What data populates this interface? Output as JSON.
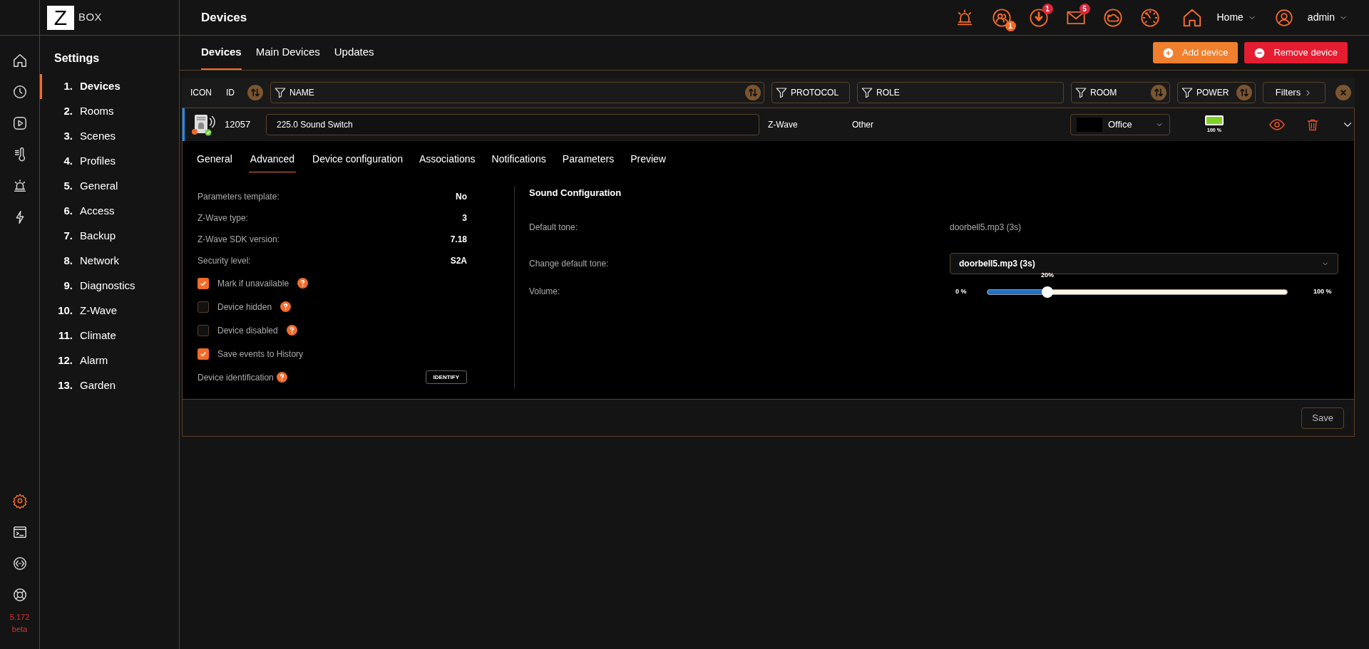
{
  "logo": {
    "letter": "Z",
    "word": "BOX"
  },
  "rail": {
    "top": [
      {
        "kind": "home",
        "selected": false
      },
      {
        "kind": "clock",
        "selected": false
      },
      {
        "kind": "play",
        "selected": false
      },
      {
        "kind": "thermometer",
        "selected": false
      },
      {
        "kind": "siren",
        "selected": false
      },
      {
        "kind": "bolt",
        "selected": false
      }
    ],
    "bottom": [
      {
        "kind": "gear",
        "selected": true
      },
      {
        "kind": "terminal",
        "selected": false
      },
      {
        "kind": "api",
        "selected": false
      },
      {
        "kind": "lifebuoy",
        "selected": false
      }
    ],
    "version": "5.172",
    "channel": "beta"
  },
  "settings": {
    "title": "Settings",
    "items": [
      {
        "number": "1.",
        "label": "Devices",
        "selected": true
      },
      {
        "number": "2.",
        "label": "Rooms",
        "selected": false
      },
      {
        "number": "3.",
        "label": "Scenes",
        "selected": false
      },
      {
        "number": "4.",
        "label": "Profiles",
        "selected": false
      },
      {
        "number": "5.",
        "label": "General",
        "selected": false
      },
      {
        "number": "6.",
        "label": "Access",
        "selected": false
      },
      {
        "number": "7.",
        "label": "Backup",
        "selected": false
      },
      {
        "number": "8.",
        "label": "Network",
        "selected": false
      },
      {
        "number": "9.",
        "label": "Diagnostics",
        "selected": false
      },
      {
        "number": "10.",
        "label": "Z-Wave",
        "selected": false
      },
      {
        "number": "11.",
        "label": "Climate",
        "selected": false
      },
      {
        "number": "12.",
        "label": "Alarm",
        "selected": false
      },
      {
        "number": "13.",
        "label": "Garden",
        "selected": false
      }
    ]
  },
  "header": {
    "title": "Devices",
    "icons": [
      {
        "kind": "siren"
      },
      {
        "kind": "users",
        "badge": "1",
        "color": "#f26b2a"
      },
      {
        "kind": "download",
        "badge": "1",
        "color": "#d9263b"
      },
      {
        "kind": "mail",
        "badge": "5",
        "color": "#d9263b"
      },
      {
        "kind": "weather"
      },
      {
        "kind": "gauge"
      }
    ],
    "home": "Home",
    "user": "admin"
  },
  "tabs": [
    {
      "label": "Devices",
      "selected": true
    },
    {
      "label": "Main Devices",
      "selected": false
    },
    {
      "label": "Updates",
      "selected": false
    }
  ],
  "actions": [
    {
      "kind": "add",
      "label": "Add device"
    },
    {
      "kind": "remove",
      "label": "Remove device"
    }
  ],
  "table": {
    "columns": [
      {
        "kind": "label",
        "label": "ICON",
        "sortable": false
      },
      {
        "kind": "label",
        "label": "ID",
        "sortable": true
      },
      {
        "kind": "filter",
        "label": "NAME",
        "sortable": true
      },
      {
        "kind": "filter",
        "label": "PROTOCOL",
        "sortable": false
      },
      {
        "kind": "filter",
        "label": "ROLE",
        "sortable": false
      },
      {
        "kind": "filter",
        "label": "ROOM",
        "sortable": true
      },
      {
        "kind": "filter",
        "label": "POWER",
        "sortable": true
      }
    ],
    "filters_button": "Filters",
    "row": {
      "id": "12057",
      "name": "225.0 Sound Switch",
      "protocol": "Z-Wave",
      "role": "Other",
      "room": "Office",
      "battery": {
        "level": 1.0,
        "reading": "100 %"
      },
      "expanded": true
    }
  },
  "detail": {
    "tabs": [
      {
        "label": "General",
        "selected": false
      },
      {
        "label": "Advanced",
        "selected": true
      },
      {
        "label": "Device configuration",
        "selected": false
      },
      {
        "label": "Associations",
        "selected": false
      },
      {
        "label": "Notifications",
        "selected": false
      },
      {
        "label": "Parameters",
        "selected": false
      },
      {
        "label": "Preview",
        "selected": false
      }
    ],
    "info": [
      {
        "label": "Parameters template:",
        "value": "No"
      },
      {
        "label": "Z-Wave type:",
        "value": "3"
      },
      {
        "label": "Z-Wave SDK version:",
        "value": "7.18"
      },
      {
        "label": "Security level:",
        "value": "S2A"
      }
    ],
    "options": [
      {
        "label": "Mark if unavailable",
        "checked": true,
        "help": true
      },
      {
        "label": "Device hidden",
        "checked": false,
        "help": true
      },
      {
        "label": "Device disabled",
        "checked": false,
        "help": true
      },
      {
        "label": "Save events to History",
        "checked": true,
        "help": false
      }
    ],
    "identification": {
      "label": "Device identification",
      "button": "IDENTIFY"
    },
    "sound": {
      "title": "Sound Configuration",
      "default_label": "Default tone:",
      "default_value": "doorbell5.mp3 (3s)",
      "change_label": "Change default tone:",
      "change_value": "doorbell5.mp3 (3s)",
      "volume_label": "Volume:",
      "volume": {
        "level": 0.2,
        "reading": "20%",
        "min": "0 %",
        "max": "100 %"
      }
    },
    "save": "Save"
  }
}
